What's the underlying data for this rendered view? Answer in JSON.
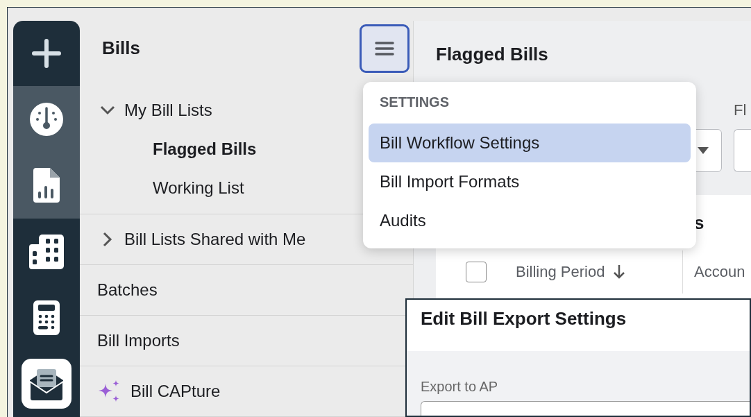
{
  "rail": {
    "items": [
      {
        "kind": "add",
        "selected": false,
        "focused": false
      },
      {
        "kind": "gauge",
        "selected": true,
        "focused": false
      },
      {
        "kind": "report",
        "selected": true,
        "focused": false
      },
      {
        "kind": "buildings",
        "selected": false,
        "focused": false
      },
      {
        "kind": "calculator",
        "selected": false,
        "focused": false
      },
      {
        "kind": "mail",
        "selected": false,
        "focused": true
      }
    ]
  },
  "sidebar": {
    "title": "Bills",
    "menu_button": {
      "pressed": true
    },
    "sections": [
      {
        "kind": "group",
        "label": "My Bill Lists",
        "expanded": true,
        "children": [
          {
            "label": "Flagged Bills",
            "selected": true
          },
          {
            "label": "Working List",
            "selected": false
          }
        ]
      },
      {
        "kind": "group",
        "label": "Bill Lists Shared with Me",
        "expanded": false
      },
      {
        "kind": "link",
        "label": "Batches"
      },
      {
        "kind": "link",
        "label": "Bill Imports"
      },
      {
        "kind": "ai",
        "label": "Bill CAPture"
      }
    ]
  },
  "main": {
    "title": "Flagged Bills",
    "filter_label": "Fl",
    "card_title": "s",
    "table": {
      "select_all": {
        "checked": false
      },
      "columns": [
        {
          "label": "Billing Period",
          "sorted_descending": true
        },
        {
          "label": "Accoun"
        }
      ]
    }
  },
  "menu": {
    "heading": "SETTINGS",
    "items": [
      {
        "label": "Bill Workflow Settings",
        "selected": true
      },
      {
        "label": "Bill Import Formats",
        "selected": false
      },
      {
        "label": "Audits",
        "selected": false
      }
    ]
  },
  "modal": {
    "title": "Edit Bill Export Settings",
    "field_label": "Export to AP"
  }
}
